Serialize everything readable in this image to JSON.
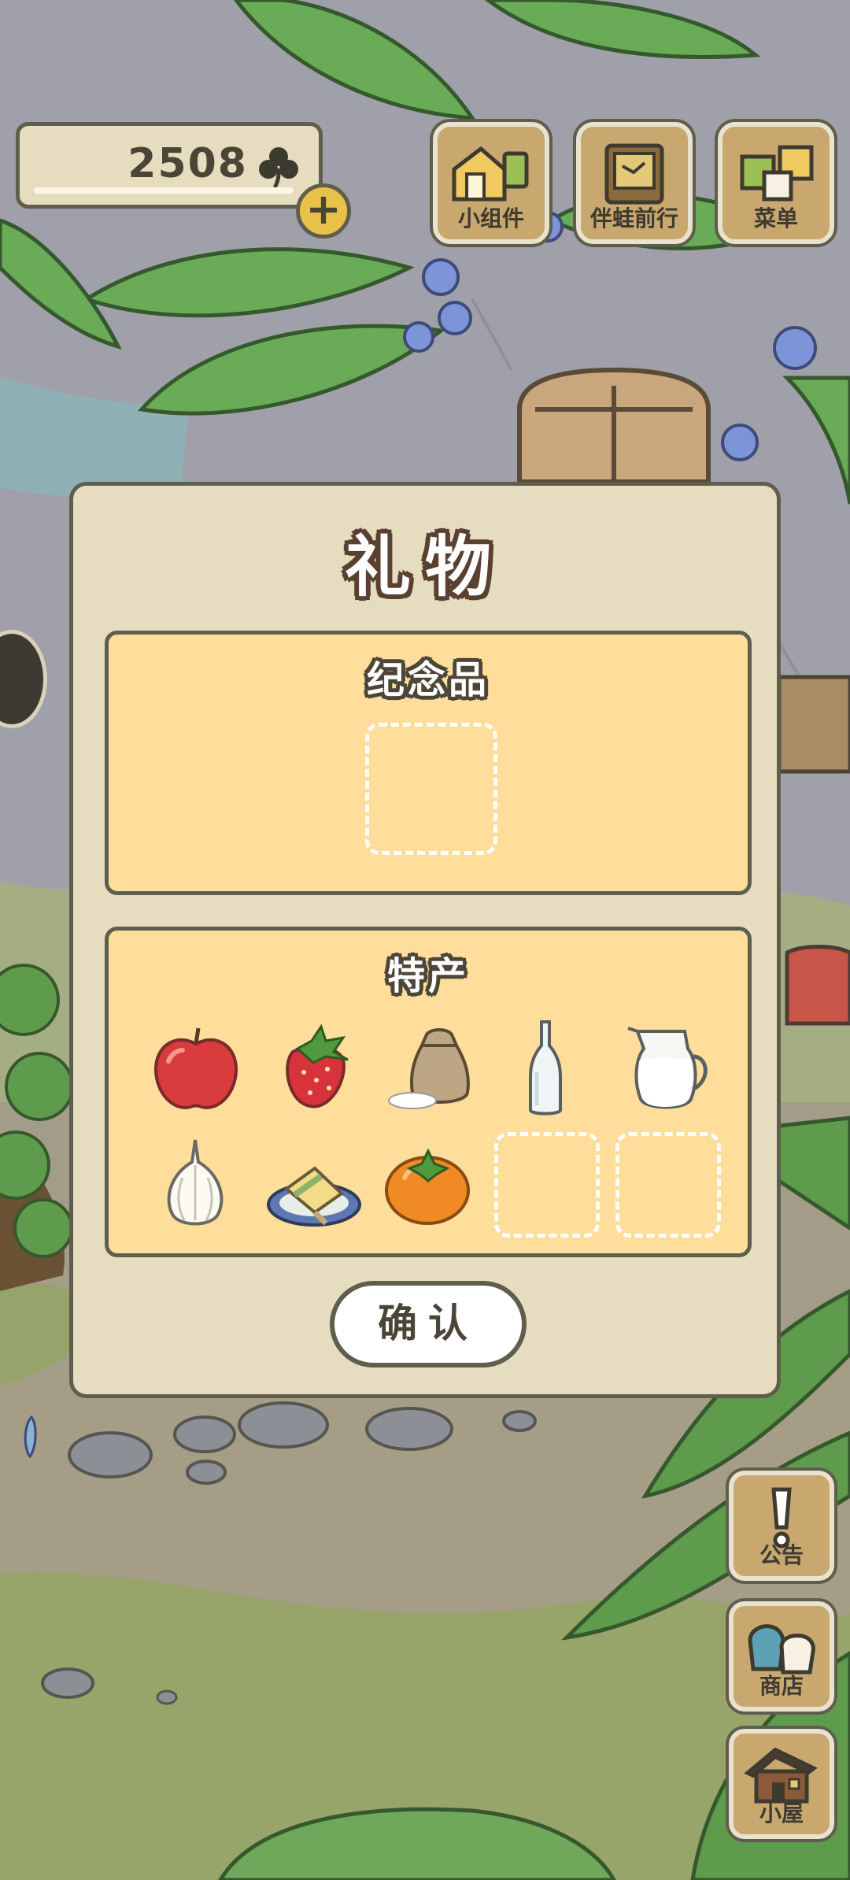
{
  "hud": {
    "clover_count": "2508",
    "plus_symbol": "+"
  },
  "top_buttons": [
    {
      "label": "小组件",
      "icon": "widget-icon"
    },
    {
      "label": "伴蛙前行",
      "icon": "journal-icon"
    },
    {
      "label": "菜单",
      "icon": "menu-icon"
    }
  ],
  "side_buttons": [
    {
      "label": "公告",
      "icon": "exclamation-icon"
    },
    {
      "label": "商店",
      "icon": "shop-bags-icon"
    },
    {
      "label": "小屋",
      "icon": "house-icon"
    }
  ],
  "dialog": {
    "title": "礼物",
    "souvenir_section": {
      "title": "纪念品"
    },
    "specialty_section": {
      "title": "特产",
      "items": [
        "apple-icon",
        "strawberry-icon",
        "rice-sack-icon",
        "glass-bottle-icon",
        "milk-jug-icon",
        "garlic-icon",
        "popsicle-plate-icon",
        "persimmon-icon"
      ]
    },
    "confirm_label": "确认"
  },
  "colors": {
    "dialog_bg": "#e6dcc0",
    "panel_bg": "#ffde9b",
    "outline": "#5f5e4d",
    "wood_button": "#c9a870"
  }
}
